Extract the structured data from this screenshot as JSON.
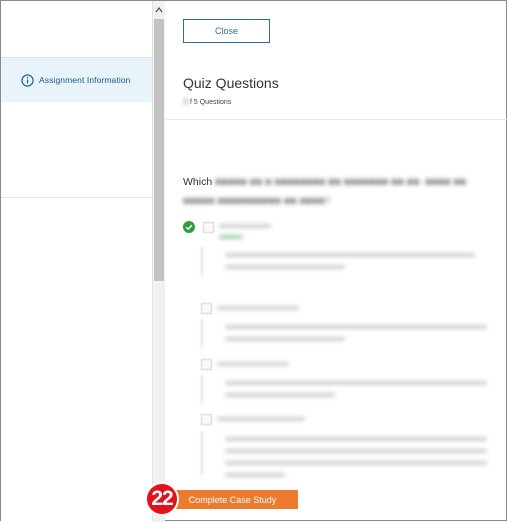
{
  "sidebar": {
    "items": [
      {
        "label": "Assignment Information",
        "icon": "info-icon"
      }
    ]
  },
  "main": {
    "close_label": "Close",
    "quiz_title": "Quiz Questions",
    "quiz_count_suffix": "f 5 Questions",
    "question_visible_word": "Which"
  },
  "footer": {
    "complete_label": "Complete Case Study",
    "step_badge": "22"
  },
  "colors": {
    "accent": "#2c6f9e",
    "sidebar_active_bg": "#e8f3fa",
    "complete_button": "#ec7a2f",
    "badge": "#e1141b",
    "correct": "#2e9e3e"
  }
}
